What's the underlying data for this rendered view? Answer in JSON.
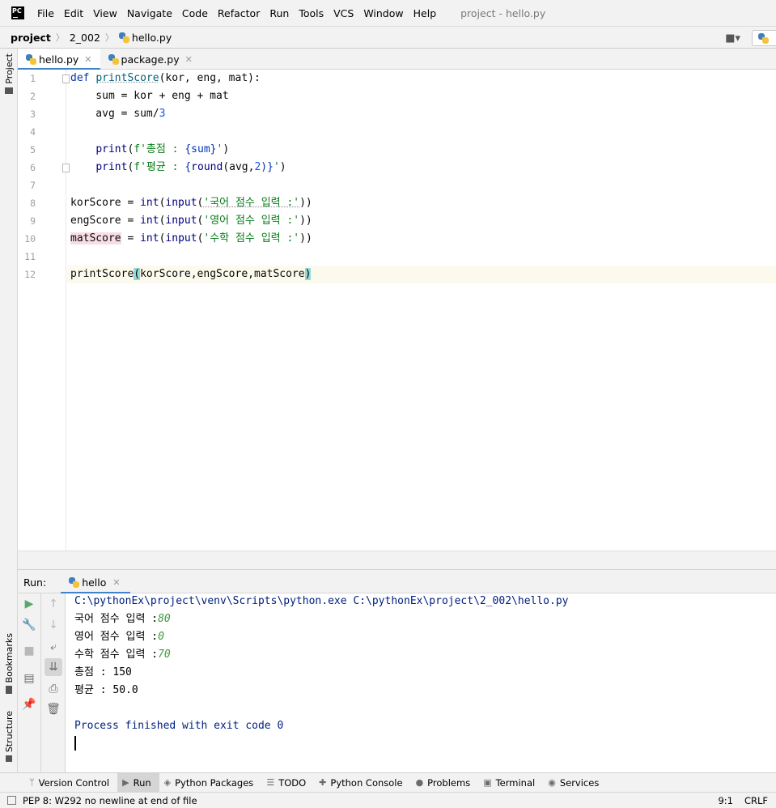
{
  "app": {
    "logo_text": "PC",
    "window_title": "project - hello.py"
  },
  "menu": {
    "items": [
      {
        "label": "File"
      },
      {
        "label": "Edit"
      },
      {
        "label": "View"
      },
      {
        "label": "Navigate"
      },
      {
        "label": "Code"
      },
      {
        "label": "Refactor"
      },
      {
        "label": "Run"
      },
      {
        "label": "Tools"
      },
      {
        "label": "VCS"
      },
      {
        "label": "Window"
      },
      {
        "label": "Help"
      }
    ]
  },
  "breadcrumb": {
    "project": "project",
    "folder": "2_002",
    "file": "hello.py"
  },
  "left_strip": {
    "project": "Project",
    "bookmarks": "Bookmarks",
    "structure": "Structure"
  },
  "editor_tabs": [
    {
      "label": "hello.py",
      "active": true
    },
    {
      "label": "package.py",
      "active": false
    }
  ],
  "editor": {
    "line_numbers": [
      "1",
      "2",
      "3",
      "4",
      "5",
      "6",
      "7",
      "8",
      "9",
      "10",
      "11",
      "12"
    ],
    "current_line": 12
  },
  "code": {
    "l1": {
      "kw": "def",
      "sp": " ",
      "fn": "printScore",
      "rest": "(kor, eng, mat):"
    },
    "l2": "    sum = kor + eng + mat",
    "l3": {
      "a": "    avg = sum/",
      "n": "3"
    },
    "l5": {
      "a": "    ",
      "b": "print",
      "c": "(",
      "d": "f'총점 : ",
      "e": "{sum}",
      "f": "'",
      "g": ")"
    },
    "l6": {
      "a": "    ",
      "b": "print",
      "c": "(",
      "d": "f'평균 : ",
      "e": "{",
      "f": "round",
      "g": "(avg,",
      "h": "2",
      "i": ")}",
      "j": "'",
      "k": ")"
    },
    "l8": {
      "a": "korScore = ",
      "b": "int",
      "c": "(",
      "d": "input",
      "e": "(",
      "f": "'국어 점수 입력 :'",
      "g": "))"
    },
    "l9": {
      "a": "engScore = ",
      "b": "int",
      "c": "(",
      "d": "input",
      "e": "(",
      "f": "'영어 점수 입력 :'",
      "g": "))"
    },
    "l10": {
      "a": "matScore",
      "b": " = ",
      "c": "int",
      "d": "(",
      "e": "input",
      "f": "(",
      "g": "'수학 점수 입력 :'",
      "h": "))"
    },
    "l12": {
      "a": "printScore",
      "b": "(",
      "c": "korScore,engScore,matScore",
      "d": ")"
    }
  },
  "run_panel": {
    "label": "Run:",
    "tab": "hello"
  },
  "console": {
    "command": "C:\\pythonEx\\project\\venv\\Scripts\\python.exe C:\\pythonEx\\project\\2_002\\hello.py",
    "prompts": [
      {
        "prompt": "국어 점수 입력 :",
        "input": "80"
      },
      {
        "prompt": "영어 점수 입력 :",
        "input": "0"
      },
      {
        "prompt": "수학 점수 입력 :",
        "input": "70"
      }
    ],
    "total": "총점 : 150",
    "average": "평균 : 50.0",
    "exit": "Process finished with exit code 0"
  },
  "bottom_tabs": [
    {
      "label": "Version Control",
      "icon": "branch-icon"
    },
    {
      "label": "Run",
      "icon": "play-icon"
    },
    {
      "label": "Python Packages",
      "icon": "layers-icon"
    },
    {
      "label": "TODO",
      "icon": "list-icon"
    },
    {
      "label": "Python Console",
      "icon": "python-icon"
    },
    {
      "label": "Problems",
      "icon": "info-icon"
    },
    {
      "label": "Terminal",
      "icon": "terminal-icon"
    },
    {
      "label": "Services",
      "icon": "play-circle-icon"
    }
  ],
  "status": {
    "message": "PEP 8: W292 no newline at end of file",
    "position": "9:1",
    "line_ending": "CRLF"
  },
  "colors": {
    "keyword": "#0033b3",
    "function": "#00627a",
    "string": "#067d17",
    "number": "#1750eb",
    "accent": "#4083c9",
    "console_path": "#002080",
    "console_input": "#3f9b3f"
  }
}
